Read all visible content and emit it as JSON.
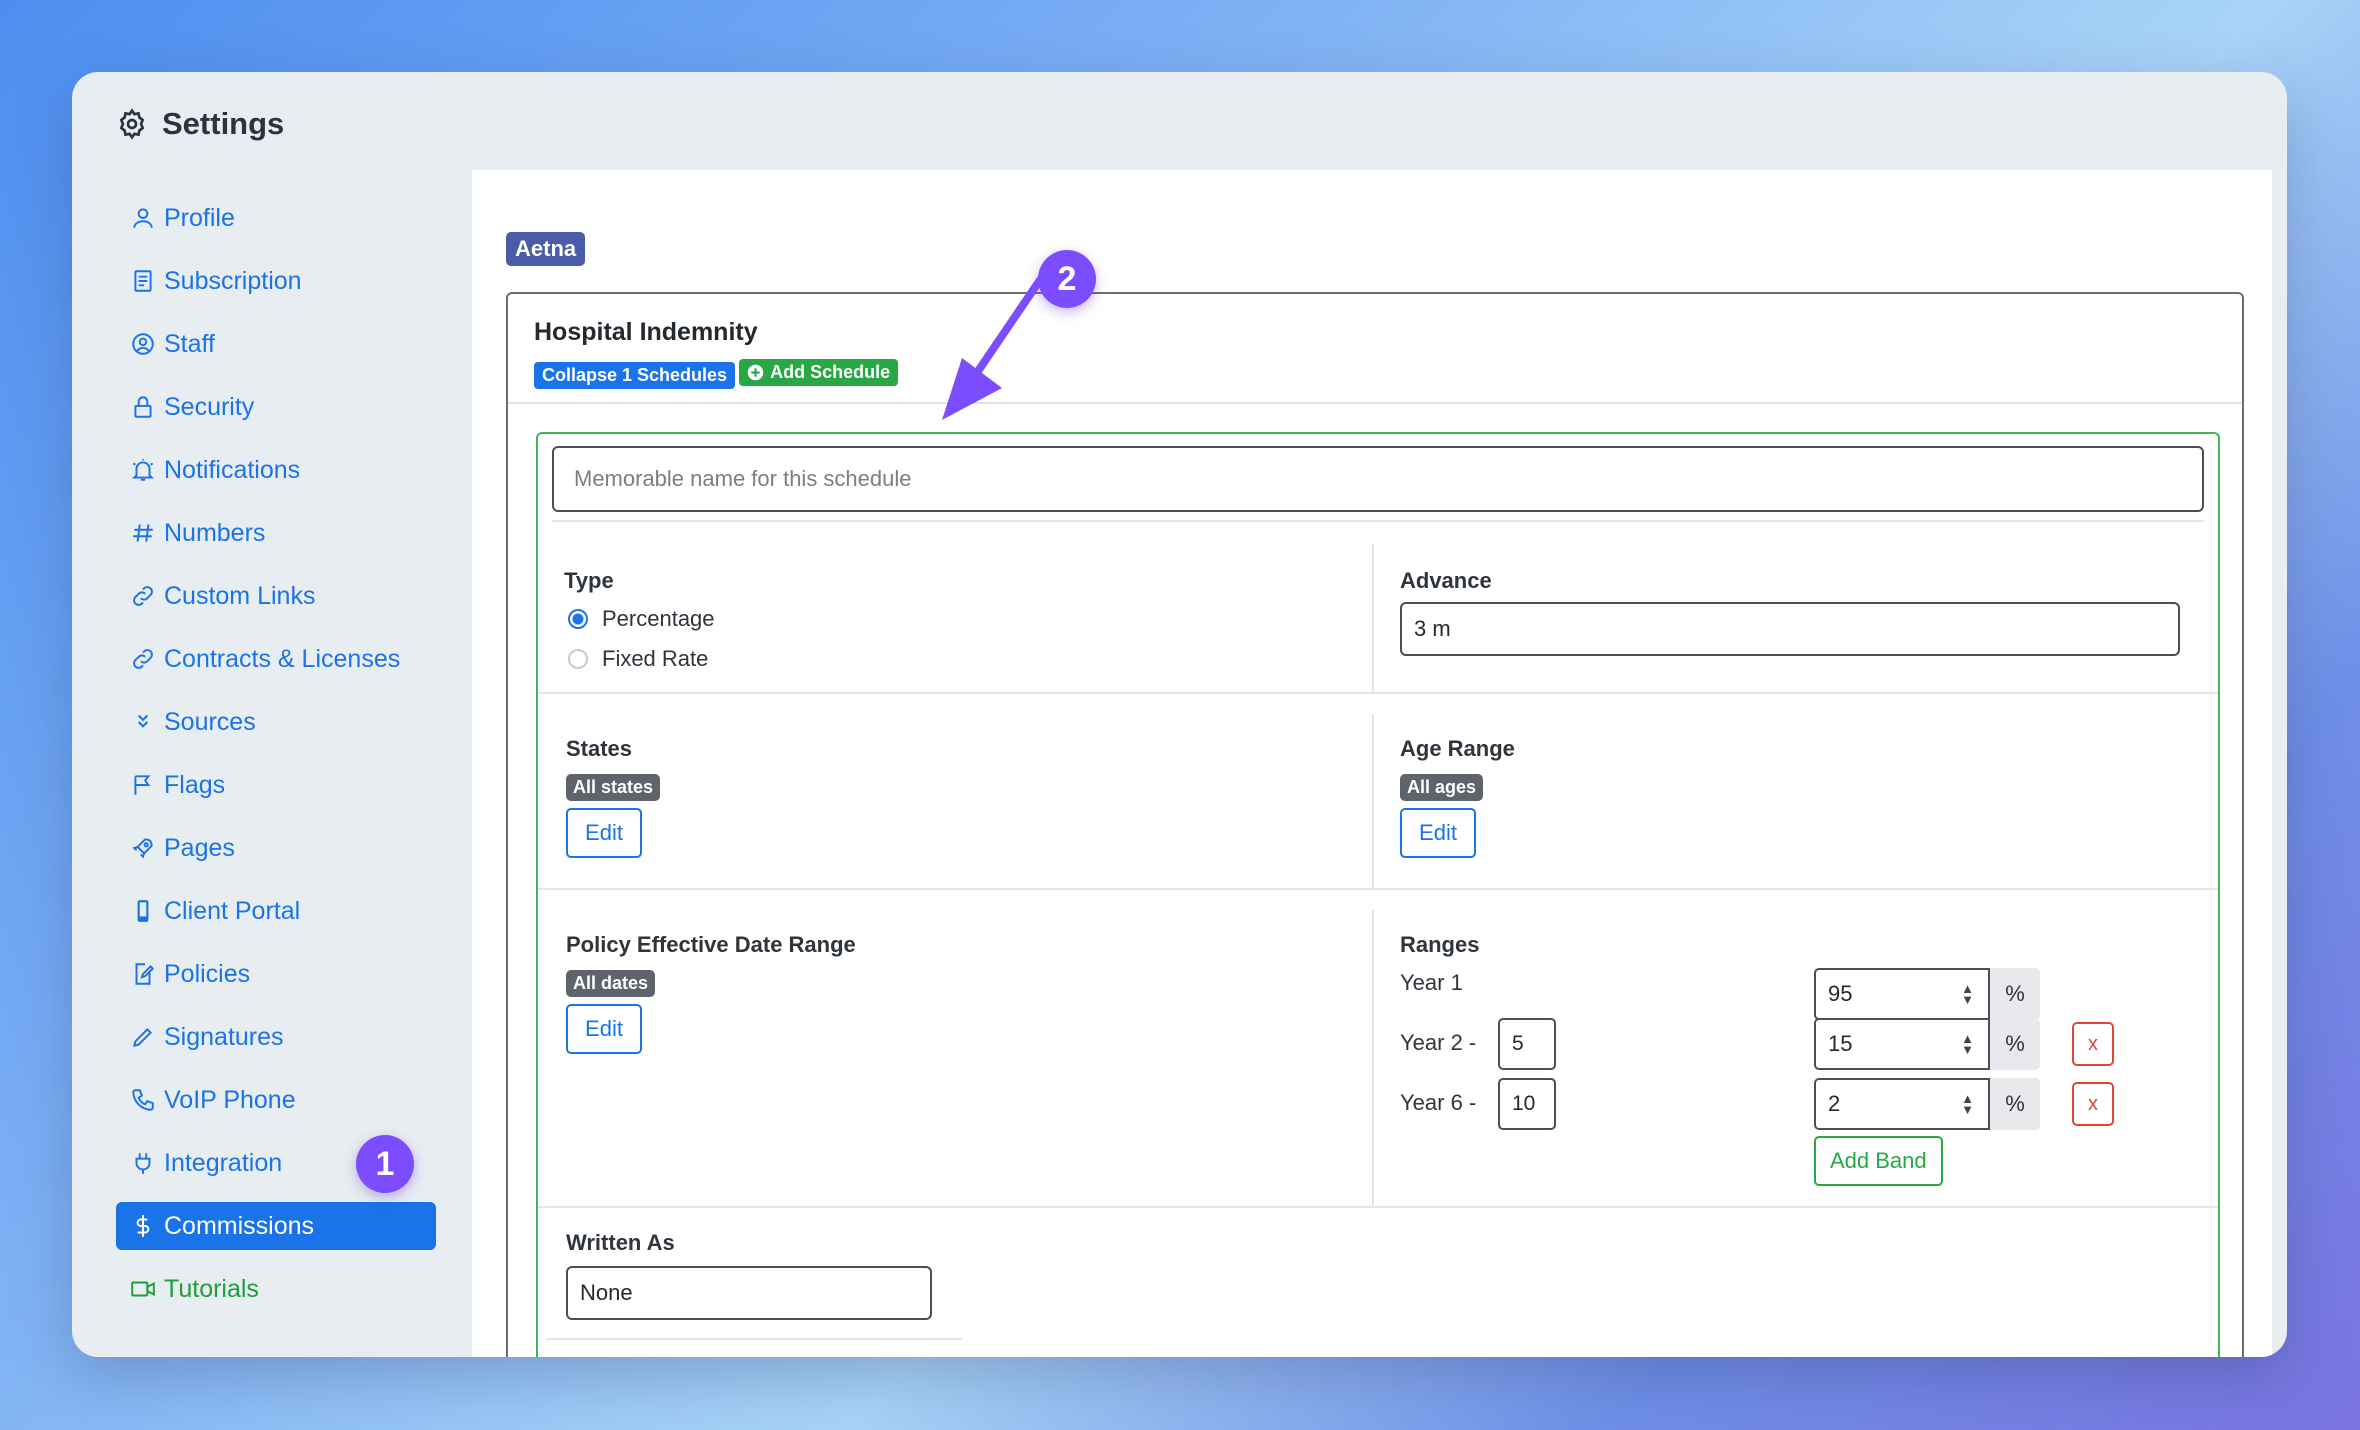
{
  "window": {
    "title": "Settings"
  },
  "sidebar": {
    "items": [
      {
        "label": "Profile",
        "icon": "user-icon"
      },
      {
        "label": "Subscription",
        "icon": "receipt-icon"
      },
      {
        "label": "Staff",
        "icon": "person-circle-icon"
      },
      {
        "label": "Security",
        "icon": "lock-icon"
      },
      {
        "label": "Notifications",
        "icon": "bell-icon"
      },
      {
        "label": "Numbers",
        "icon": "hash-icon"
      },
      {
        "label": "Custom Links",
        "icon": "link-icon"
      },
      {
        "label": "Contracts & Licenses",
        "icon": "link-icon"
      },
      {
        "label": "Sources",
        "icon": "chevrons-down-icon"
      },
      {
        "label": "Flags",
        "icon": "flag-icon"
      },
      {
        "label": "Pages",
        "icon": "rocket-icon"
      },
      {
        "label": "Client Portal",
        "icon": "phone-icon"
      },
      {
        "label": "Policies",
        "icon": "document-edit-icon"
      },
      {
        "label": "Signatures",
        "icon": "pen-icon"
      },
      {
        "label": "VoIP Phone",
        "icon": "telephone-icon"
      },
      {
        "label": "Integration",
        "icon": "plug-icon"
      },
      {
        "label": "Commissions",
        "icon": "dollar-icon",
        "active": true
      },
      {
        "label": "Tutorials",
        "icon": "video-icon"
      }
    ]
  },
  "annotations": {
    "step1": "1",
    "step2": "2"
  },
  "carrier": {
    "name": "Aetna"
  },
  "product": {
    "title": "Hospital Indemnity",
    "collapse_label": "Collapse 1 Schedules",
    "add_schedule_label": "Add Schedule"
  },
  "schedule": {
    "name_placeholder": "Memorable name for this schedule",
    "type": {
      "label": "Type",
      "options": [
        "Percentage",
        "Fixed Rate"
      ],
      "selected": "Percentage"
    },
    "advance": {
      "label": "Advance",
      "value": "3 m"
    },
    "states": {
      "label": "States",
      "badge": "All states",
      "edit": "Edit"
    },
    "age_range": {
      "label": "Age Range",
      "badge": "All ages",
      "edit": "Edit"
    },
    "policy_date": {
      "label": "Policy Effective Date Range",
      "badge": "All dates",
      "edit": "Edit"
    },
    "ranges": {
      "label": "Ranges",
      "rows": [
        {
          "label": "Year 1",
          "start": "",
          "value": "95"
        },
        {
          "label": "Year 2 -",
          "start": "5",
          "value": "15"
        },
        {
          "label": "Year 6 -",
          "start": "10",
          "value": "2"
        }
      ],
      "unit": "%",
      "delete_label": "x",
      "add_band_label": "Add Band"
    },
    "written_as": {
      "label": "Written As",
      "value": "None"
    }
  },
  "colors": {
    "accent": "#1a73e8",
    "success": "#27a844",
    "danger": "#e0453a",
    "annotation": "#7c4dff"
  }
}
